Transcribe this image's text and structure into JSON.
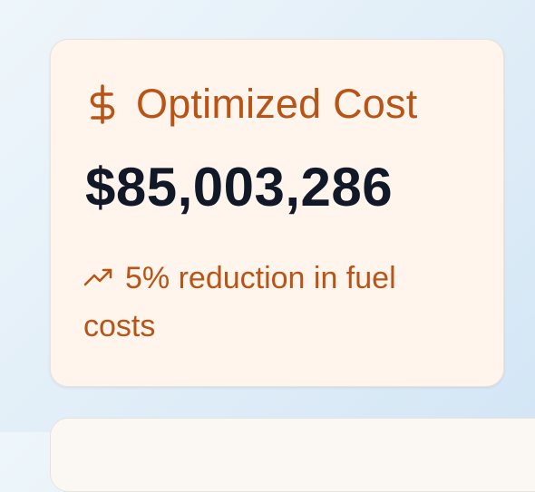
{
  "card": {
    "title": "Optimized Cost",
    "value": "$85,003,286",
    "note": "5% reduction in fuel costs",
    "icon": "dollar-icon",
    "note_icon": "trending-up-icon",
    "accent_color": "#b95416",
    "background_color": "#fff5ed",
    "value_color": "#111827"
  }
}
